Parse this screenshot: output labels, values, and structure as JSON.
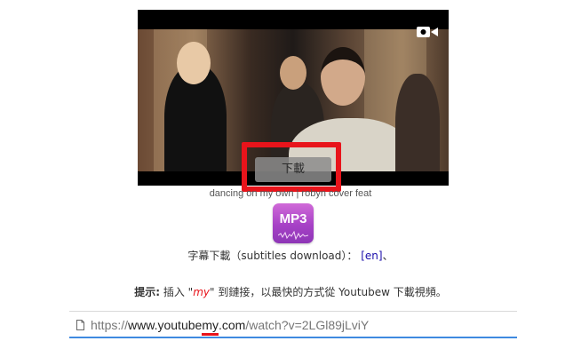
{
  "video": {
    "download_button_label": "下載",
    "camera_icon": "video-camera-icon"
  },
  "caption": "dancing on my own | robyn cover feat",
  "mp3": {
    "label": "MP3",
    "icon": "mp3-icon"
  },
  "subtitles": {
    "label": "字幕下載（subtitles download）：",
    "link": "[en]",
    "suffix": "、"
  },
  "tip": {
    "prefix": "提示:",
    "text_before": " 插入 \"",
    "highlight": "my",
    "text_after": "\" 到鏈接，以最快的方式從 Youtubew 下載視頻。"
  },
  "url": {
    "scheme": "https://",
    "host_a": "www.youtube",
    "host_injected": "my",
    "host_b": ".com",
    "path": "/watch?v=2LGl89jLviY"
  },
  "colors": {
    "highlight_red": "#e8141b",
    "link_blue": "#1a0dab",
    "url_focus": "#3f8ae0",
    "mp3_purple": "#a641c6"
  }
}
